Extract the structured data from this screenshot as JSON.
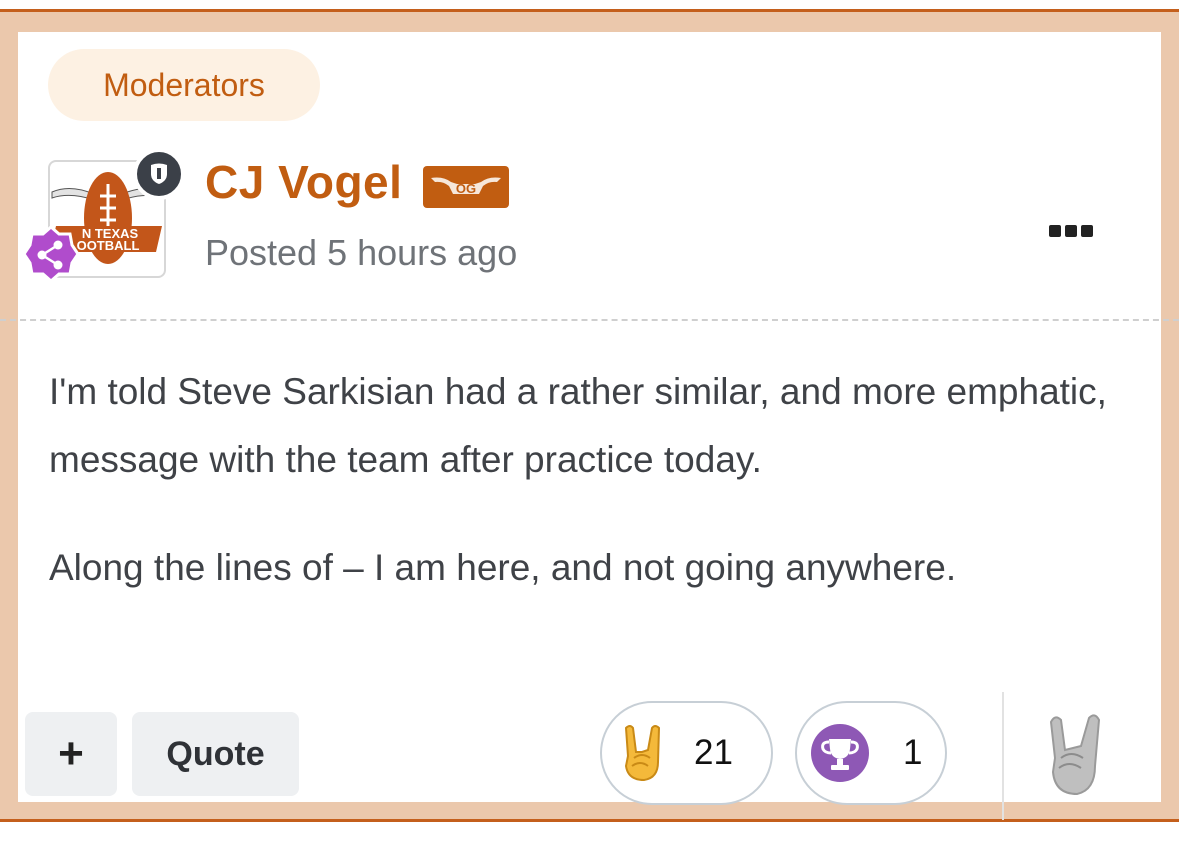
{
  "group": {
    "label": "Moderators"
  },
  "author": {
    "name": "CJ Vogel",
    "badge": "OG",
    "avatar_text": [
      "N TEXAS",
      "OOTBALL"
    ],
    "posted": "Posted 5 hours ago"
  },
  "post": {
    "paragraphs": [
      "I'm told Steve Sarkisian had a rather similar, and more emphatic, message with the team after practice today.",
      "Along the lines of – I am here, and not going anywhere."
    ]
  },
  "actions": {
    "plus_label": "+",
    "quote_label": "Quote"
  },
  "reactions": [
    {
      "icon": "horns-hand-icon",
      "count": "21"
    },
    {
      "icon": "trophy-icon",
      "count": "1"
    }
  ],
  "colors": {
    "accent": "#c15d11",
    "frame": "#ebc8ac",
    "frame_border": "#c45f1c",
    "mod_badge": "#3b4048",
    "share_badge": "#b04ccc",
    "trophy": "#8e58b5",
    "horns": "#f4b93a"
  }
}
